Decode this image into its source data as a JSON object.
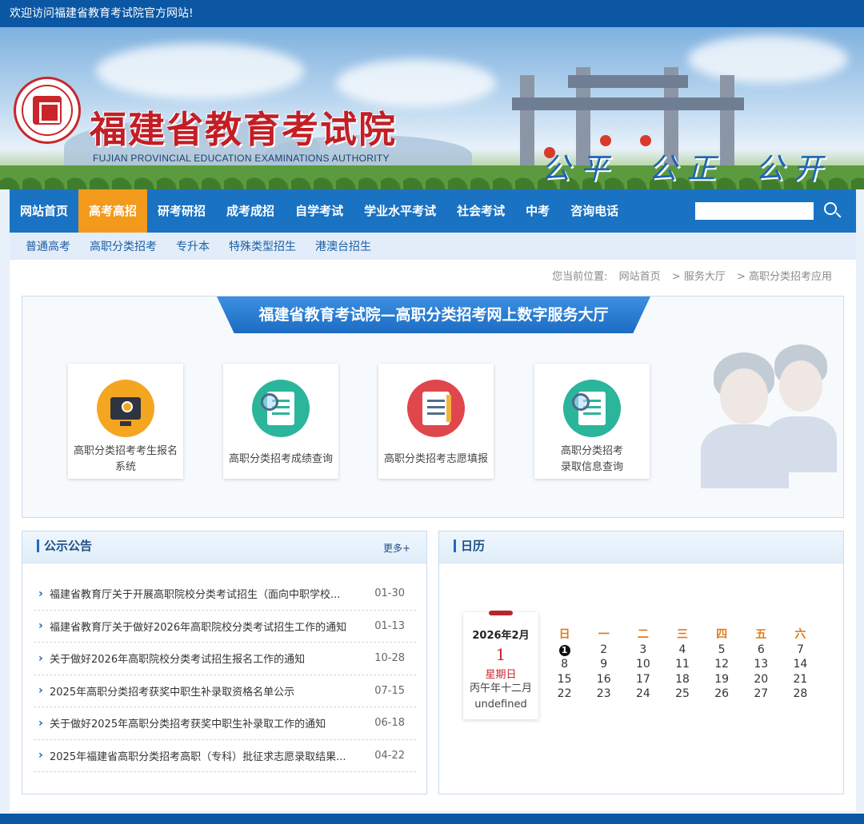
{
  "topbar": {
    "welcome": "欢迎访问福建省教育考试院官方网站!"
  },
  "header": {
    "org_name": "福建省教育考试院",
    "org_name_en": "FUJIAN PROVINCIAL EDUCATION EXAMINATIONS AUTHORITY",
    "motto": "公平 公正 公开"
  },
  "nav": {
    "items": [
      {
        "label": "网站首页",
        "active": false
      },
      {
        "label": "高考高招",
        "active": true
      },
      {
        "label": "研考研招",
        "active": false
      },
      {
        "label": "成考成招",
        "active": false
      },
      {
        "label": "自学考试",
        "active": false
      },
      {
        "label": "学业水平考试",
        "active": false
      },
      {
        "label": "社会考试",
        "active": false
      },
      {
        "label": "中考",
        "active": false
      },
      {
        "label": "咨询电话",
        "active": false
      }
    ],
    "search_value": "",
    "active_color": "#f39a1c",
    "bar_color": "#1a72c3"
  },
  "subnav": {
    "items": [
      "普通高考",
      "高职分类招考",
      "专升本",
      "特殊类型招生",
      "港澳台招生"
    ]
  },
  "breadcrumb": {
    "label": "您当前位置:",
    "items": [
      "网站首页",
      "> 服务大厅",
      "> 高职分类招考应用"
    ]
  },
  "hall": {
    "title": "福建省教育考试院—高职分类招考网上数字服务大厅",
    "services": [
      {
        "label_line1": "高职分类招考考生报名",
        "label_line2": "系统",
        "icon": "monitor-upload-icon",
        "color": "#f4a621"
      },
      {
        "label_line1": "高职分类招考成绩查询",
        "label_line2": "",
        "icon": "score-search-icon",
        "color": "#2bb59b"
      },
      {
        "label_line1": "高职分类招考志愿填报",
        "label_line2": "",
        "icon": "checklist-pencil-icon",
        "color": "#e0474c"
      },
      {
        "label_line1": "高职分类招考",
        "label_line2": "录取信息查询",
        "icon": "admission-search-icon",
        "color": "#2bb59b"
      }
    ]
  },
  "notices": {
    "title": "公示公告",
    "more": "更多+",
    "items": [
      {
        "text": "福建省教育厅关于开展高职院校分类考试招生（面向中职学校...",
        "date": "01-30"
      },
      {
        "text": "福建省教育厅关于做好2026年高职院校分类考试招生工作的通知",
        "date": "01-13"
      },
      {
        "text": "关于做好2026年高职院校分类考试招生报名工作的通知",
        "date": "10-28"
      },
      {
        "text": "2025年高职分类招考获奖中职生补录取资格名单公示",
        "date": "07-15"
      },
      {
        "text": "关于做好2025年高职分类招考获奖中职生补录取工作的通知",
        "date": "06-18"
      },
      {
        "text": "2025年福建省高职分类招考高职（专科）批征求志愿录取结果...",
        "date": "04-22"
      }
    ]
  },
  "calendar": {
    "title": "日历",
    "year_month": "2026年2月",
    "day": "1",
    "weekday": "星期日",
    "lunar": "丙午年十二月",
    "lunar_day": "undefined",
    "headers": [
      "日",
      "一",
      "二",
      "三",
      "四",
      "五",
      "六"
    ],
    "weeks": [
      [
        "1",
        "2",
        "3",
        "4",
        "5",
        "6",
        "7"
      ],
      [
        "8",
        "9",
        "10",
        "11",
        "12",
        "13",
        "14"
      ],
      [
        "15",
        "16",
        "17",
        "18",
        "19",
        "20",
        "21"
      ],
      [
        "22",
        "23",
        "24",
        "25",
        "26",
        "27",
        "28"
      ]
    ],
    "today": "1"
  }
}
